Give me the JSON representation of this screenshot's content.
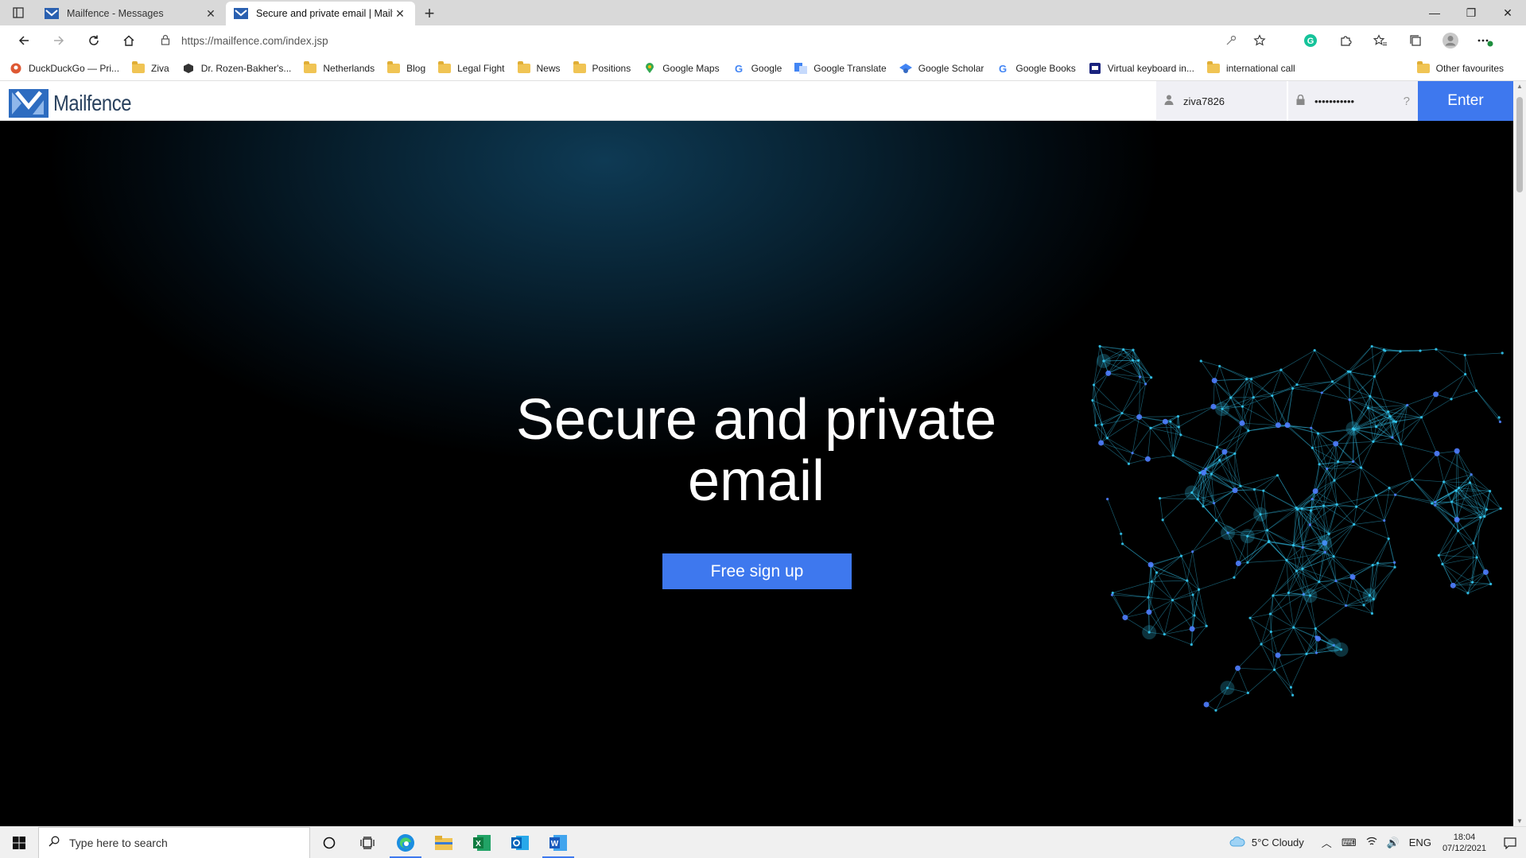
{
  "browser": {
    "tabs": [
      {
        "title": "Mailfence - Messages",
        "active": false
      },
      {
        "title": "Secure and private email | Mailfe",
        "active": true
      }
    ],
    "url": "https://mailfence.com/index.jsp",
    "bookmarks": [
      {
        "label": "DuckDuckGo — Pri...",
        "icon": "duckduckgo-icon"
      },
      {
        "label": "Ziva",
        "icon": "folder-icon"
      },
      {
        "label": "Dr. Rozen-Bakher's...",
        "icon": "cube-icon"
      },
      {
        "label": "Netherlands",
        "icon": "folder-icon"
      },
      {
        "label": "Blog",
        "icon": "folder-icon"
      },
      {
        "label": "Legal Fight",
        "icon": "folder-icon"
      },
      {
        "label": "News",
        "icon": "folder-icon"
      },
      {
        "label": "Positions",
        "icon": "folder-icon"
      },
      {
        "label": "Google Maps",
        "icon": "maps-pin-icon"
      },
      {
        "label": "Google",
        "icon": "google-icon"
      },
      {
        "label": "Google Translate",
        "icon": "translate-icon"
      },
      {
        "label": "Google Scholar",
        "icon": "scholar-icon"
      },
      {
        "label": "Google Books",
        "icon": "google-icon"
      },
      {
        "label": "Virtual keyboard in...",
        "icon": "keyboard-icon"
      },
      {
        "label": "international call",
        "icon": "folder-icon"
      }
    ],
    "other_favourites": "Other favourites"
  },
  "site": {
    "brand": "Mailfence",
    "login": {
      "username": "ziva7826",
      "password": "•••••••••••",
      "help": "?",
      "enter_label": "Enter"
    },
    "hero": {
      "title_line1": "Secure and private",
      "title_line2": "email",
      "cta": "Free sign up"
    }
  },
  "taskbar": {
    "search_placeholder": "Type here to search",
    "weather": "5°C  Cloudy",
    "language": "ENG",
    "time": "18:04",
    "date": "07/12/2021"
  },
  "colors": {
    "accent": "#3e78ee",
    "hero_dark": "#020a10",
    "shield_glow": "#33c6f0"
  }
}
